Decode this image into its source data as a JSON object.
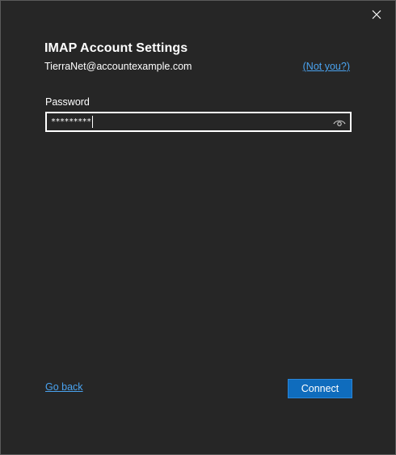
{
  "dialog": {
    "title": "IMAP Account Settings",
    "account_email": "TierraNet@accountexample.com",
    "not_you_label": "(Not you?)",
    "close_icon": "close-icon"
  },
  "password": {
    "label": "Password",
    "masked_value": "*********",
    "reveal_icon": "eye-icon"
  },
  "footer": {
    "go_back_label": "Go back",
    "connect_label": "Connect"
  },
  "colors": {
    "background": "#262626",
    "link": "#4aa3f0",
    "primary_button": "#0f6cbd"
  }
}
